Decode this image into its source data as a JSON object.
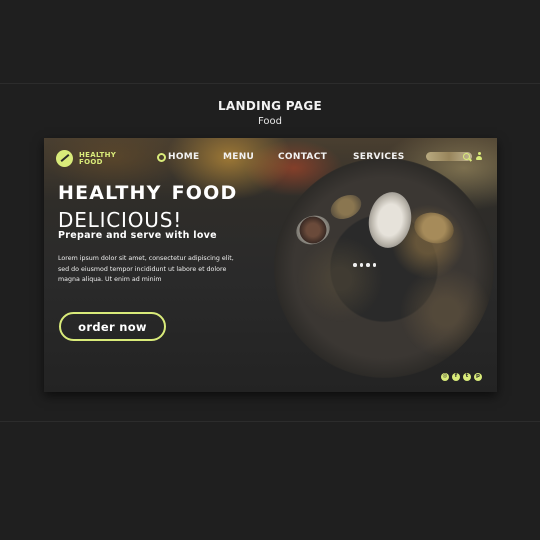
{
  "mockup": {
    "title": "LANDING PAGE",
    "subtitle": "Food"
  },
  "logo": {
    "line1": "HEALTHY",
    "line2": "FOOD"
  },
  "nav": {
    "items": [
      {
        "label": "HOME"
      },
      {
        "label": "MENU"
      },
      {
        "label": "CONTACT"
      },
      {
        "label": "SERVICES"
      }
    ]
  },
  "hero": {
    "title_word1": "HEALTHY",
    "title_word2": "FOOD",
    "subtitle": "DELICIOUS!",
    "tagline": "Prepare and serve with love",
    "body": "Lorem ipsum dolor sit amet, consectetur adipiscing elit, sed do eiusmod tempor incididunt ut labore et dolore magna aliqua. Ut enim ad minim",
    "cta_label": "order now"
  },
  "carousel": {
    "dot_count": 4
  },
  "socials": [
    {
      "icon": "instagram-icon",
      "glyph": "◎"
    },
    {
      "icon": "facebook-icon",
      "glyph": "f"
    },
    {
      "icon": "twitter-icon",
      "glyph": "t"
    },
    {
      "icon": "pinterest-icon",
      "glyph": "p"
    }
  ],
  "colors": {
    "background": "#1f1f1f",
    "accent": "#d9eb7a",
    "text": "#ffffff"
  }
}
